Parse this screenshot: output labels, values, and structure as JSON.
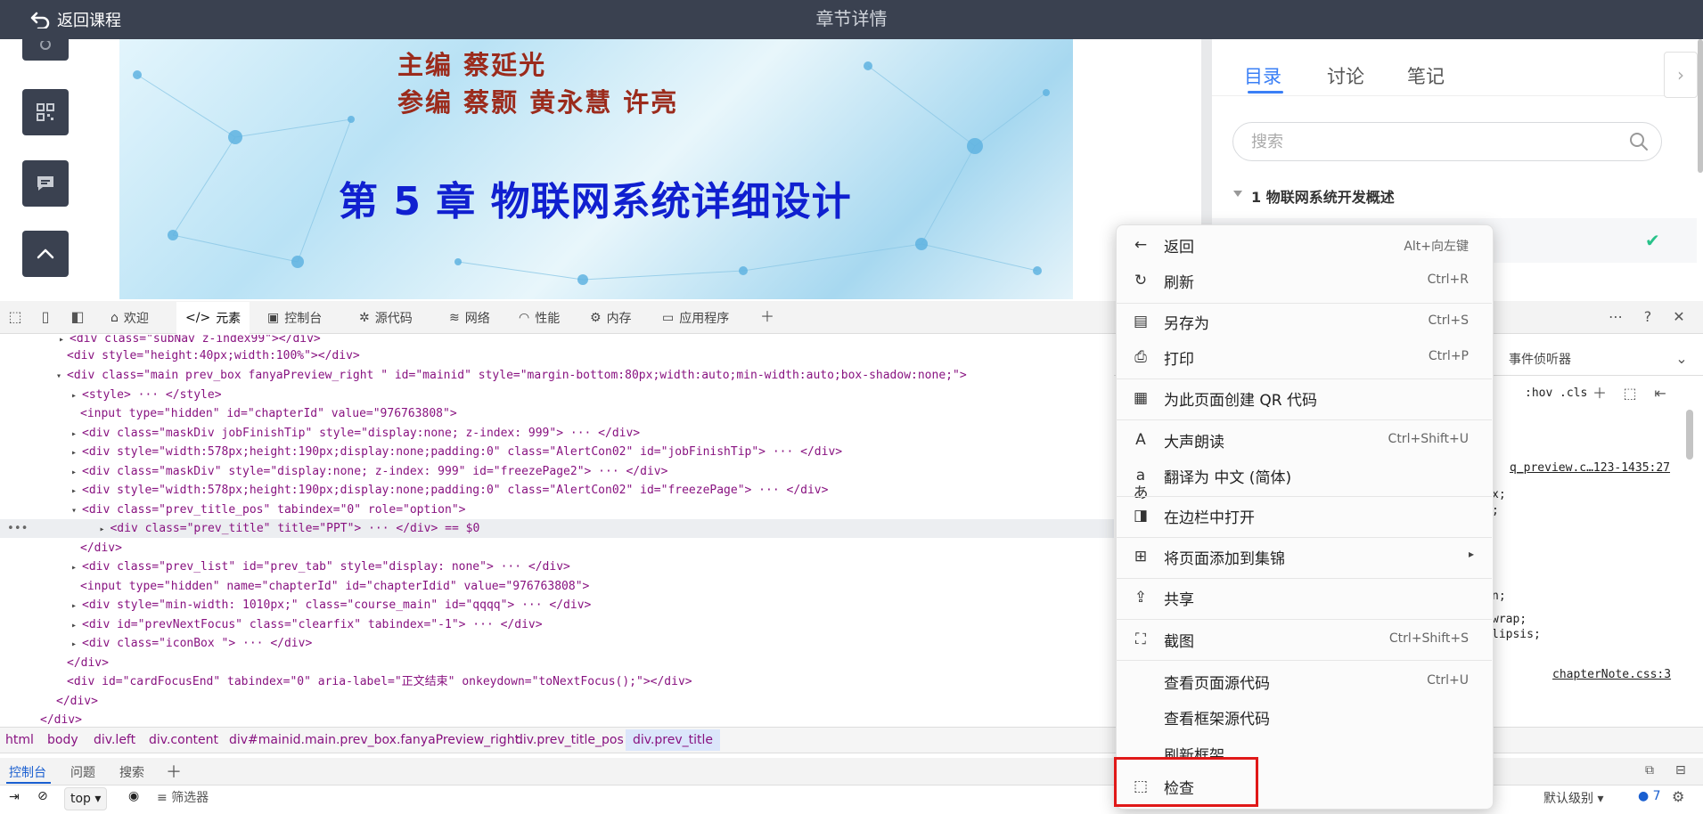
{
  "header": {
    "back_label": "返回课程",
    "title": "章节详情"
  },
  "slide": {
    "line1": "主编 蔡延光",
    "line2": "参编 蔡颢 黄永慧 许亮",
    "chapter_title": "第 5 章  物联网系统详细设计"
  },
  "panel": {
    "tabs": [
      "目录",
      "讨论",
      "笔记"
    ],
    "active_tab": "目录",
    "search_placeholder": "搜索",
    "section1": "1 物联网系统开发概述"
  },
  "devtools": {
    "tabs": [
      "欢迎",
      "元素",
      "控制台",
      "源代码",
      "网络",
      "性能",
      "内存",
      "应用程序"
    ],
    "right_tab": "事件侦听器",
    "styles_toolbar": [
      ":hov",
      ".cls"
    ],
    "code_lines": [
      {
        "t": "<div class=\"subNav z-index99\"></div>"
      },
      {
        "t": "<div style=\"height:40px;width:100%\"></div>"
      },
      {
        "t": "<div class=\"main prev_box  fanyaPreview_right  \" id=\"mainid\" style=\"margin-bottom:80px;width:auto;min-width:auto;box-shadow:none;\">"
      },
      {
        "t": "<style> ··· </style>"
      },
      {
        "t": "<input type=\"hidden\" id=\"chapterId\" value=\"976763808\">"
      },
      {
        "t": "<div class=\"maskDiv jobFinishTip\" style=\"display:none; z-index: 999\"> ··· </div>"
      },
      {
        "t": "<div style=\"width:578px;height:190px;display:none;padding:0\" class=\"AlertCon02\" id=\"jobFinishTip\"> ··· </div>"
      },
      {
        "t": "<div class=\"maskDiv\" style=\"display:none; z-index: 999\" id=\"freezePage2\"> ··· </div>"
      },
      {
        "t": "<div style=\"width:578px;height:190px;display:none;padding:0\" class=\"AlertCon02\" id=\"freezePage\"> ··· </div>"
      },
      {
        "t": "<div class=\"prev_title_pos\" tabindex=\"0\" role=\"option\">"
      },
      {
        "t": "<div class=\"prev_title\" title=\"PPT\"> ··· </div>  == $0"
      },
      {
        "t": "</div>"
      },
      {
        "t": "<div class=\"prev_list\" id=\"prev_tab\" style=\"display: none\"> ··· </div>"
      },
      {
        "t": "<input type=\"hidden\" name=\"chapterId\" id=\"chapterIdid\" value=\"976763808\">"
      },
      {
        "t": "<div style=\"min-width: 1010px;\" class=\"course_main\" id=\"qqqq\"> ··· </div>"
      },
      {
        "t": "<div id=\"prevNextFocus\" class=\"clearfix\" tabindex=\"-1\"> ··· </div>"
      },
      {
        "t": "<div class=\"iconBox \"> ··· </div>"
      },
      {
        "t": "</div>"
      },
      {
        "t": "<div id=\"cardFocusEnd\" tabindex=\"0\" aria-label=\"正文结束\" onkeydown=\"toNextFocus();\"></div>"
      },
      {
        "t": "</div>"
      },
      {
        "t": "</div>"
      }
    ],
    "styles_links": [
      "q_preview.c…123-1435:27",
      "chapterNote.css:3"
    ],
    "styles_fragments": [
      "x;",
      ";",
      "n;",
      "wrap;",
      "lipsis;"
    ],
    "breadcrumb": [
      "html",
      "body",
      "div.left",
      "div.content",
      "div#mainid.main.prev_box.fanyaPreview_right.",
      "div.prev_title_pos",
      "div.prev_title"
    ],
    "drawer_tabs": [
      "控制台",
      "问题",
      "搜索"
    ],
    "console": {
      "context": "top",
      "filter_label": "筛选器",
      "level": "默认级别",
      "issues": "7"
    }
  },
  "context_menu": {
    "items": [
      {
        "label": "返回",
        "shortcut": "Alt+向左键",
        "icon": "arrow-left-icon"
      },
      {
        "label": "刷新",
        "shortcut": "Ctrl+R",
        "icon": "refresh-icon"
      },
      {
        "label": "另存为",
        "shortcut": "Ctrl+S",
        "icon": "save-icon"
      },
      {
        "label": "打印",
        "shortcut": "Ctrl+P",
        "icon": "print-icon"
      },
      {
        "label": "为此页面创建 QR 代码",
        "shortcut": "",
        "icon": "qr-code-icon"
      },
      {
        "label": "大声朗读",
        "shortcut": "Ctrl+Shift+U",
        "icon": "read-aloud-icon"
      },
      {
        "label": "翻译为 中文 (简体)",
        "shortcut": "",
        "icon": "translate-icon"
      },
      {
        "label": "在边栏中打开",
        "shortcut": "",
        "icon": "sidebar-open-icon"
      },
      {
        "label": "将页面添加到集锦",
        "shortcut": "",
        "icon": "collections-icon"
      },
      {
        "label": "共享",
        "shortcut": "",
        "icon": "share-icon"
      },
      {
        "label": "截图",
        "shortcut": "Ctrl+Shift+S",
        "icon": "screenshot-icon"
      },
      {
        "label": "查看页面源代码",
        "shortcut": "Ctrl+U",
        "icon": ""
      },
      {
        "label": "查看框架源代码",
        "shortcut": "",
        "icon": ""
      },
      {
        "label": "刷新框架",
        "shortcut": "",
        "icon": ""
      },
      {
        "label": "检查",
        "shortcut": "",
        "icon": "inspect-icon"
      }
    ],
    "highlight_color": "#e01818"
  },
  "colors": {
    "header_bg": "#3a4150",
    "accent": "#3a7ff6",
    "check": "#28c28a"
  }
}
